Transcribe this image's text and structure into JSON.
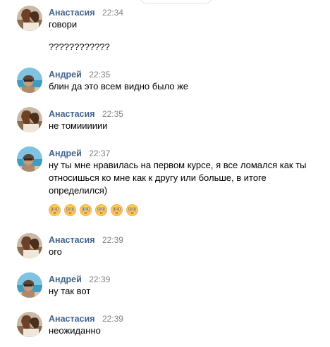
{
  "messages": [
    {
      "author": "Анастасия",
      "time": "22:34",
      "lines": [
        "говори"
      ],
      "avatar": "anastasia"
    },
    {
      "author": "",
      "time": "",
      "lines": [
        "????????????"
      ],
      "avatar": ""
    },
    {
      "author": "Андрей",
      "time": "22:35",
      "lines": [
        "блин да это всем видно было же"
      ],
      "avatar": "andrey"
    },
    {
      "author": "Анастасия",
      "time": "22:35",
      "lines": [
        "не томииииии"
      ],
      "avatar": "anastasia"
    },
    {
      "author": "Андрей",
      "time": "22:37",
      "lines": [
        "ну ты мне нравилась на первом курсе, я все ломался как ты",
        "относишься ко мне как к другу или больше, в итоге",
        "определился)"
      ],
      "avatar": "andrey"
    },
    {
      "author": "Анастасия",
      "time": "22:39",
      "lines": [
        "ого"
      ],
      "avatar": "anastasia"
    },
    {
      "author": "Андрей",
      "time": "22:39",
      "lines": [
        "ну так вот"
      ],
      "avatar": "andrey"
    },
    {
      "author": "Анастасия",
      "time": "22:39",
      "lines": [
        "неожиданно"
      ],
      "avatar": "anastasia"
    }
  ],
  "emojis": {
    "count": 6,
    "icon": "flushed-face-emoji",
    "colors": {
      "face": "#ffcc4d",
      "outline": "#e8a33d",
      "cheek": "#f4a6a6"
    }
  },
  "colors": {
    "author": "#42648b",
    "time": "#828282",
    "text": "#000000"
  }
}
